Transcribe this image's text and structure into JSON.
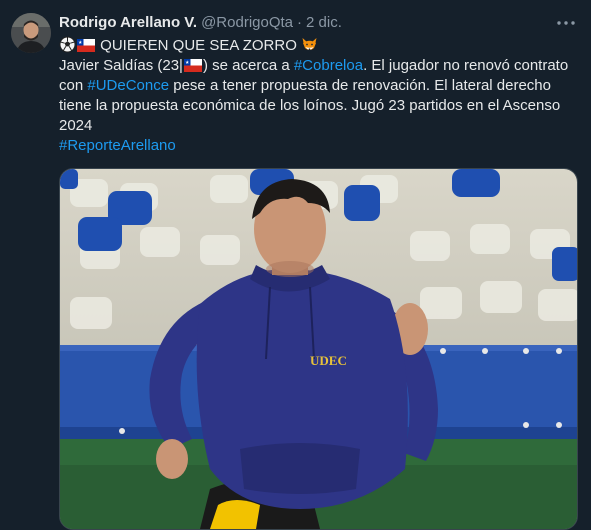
{
  "author": {
    "display_name": "Rodrigo Arellano V.",
    "handle": "@RodrigoQta",
    "separator": "·",
    "date": "2 dic."
  },
  "tweet": {
    "line1_text": "QUIEREN QUE SEA ZORRO",
    "line2_pre": "Javier Saldías (23|",
    "line2_mid": ") se acerca a ",
    "line2_tag": "#Cobreloa",
    "line2_post": ". El jugador no renovó contrato",
    "line3_pre": "con ",
    "line3_tag": "#UDeConce",
    "line3_post": " pese a tener propuesta de renovación. El lateral derecho",
    "line4": "tiene la propuesta económica de los loínos. Jugó 23 partidos en el Ascenso",
    "line5": "2024",
    "line6_tag": "#ReporteArellano"
  },
  "media": {
    "jersey_text": "UDEC"
  },
  "icons": {
    "more": "more-dots-icon",
    "soccer": "soccer-ball-icon",
    "flag": "chile-flag-icon",
    "fox": "fox-face-icon"
  },
  "colors": {
    "background": "#15202b",
    "link": "#1d9bf0",
    "muted": "#8b98a5",
    "hoodie": "#2e3587"
  }
}
